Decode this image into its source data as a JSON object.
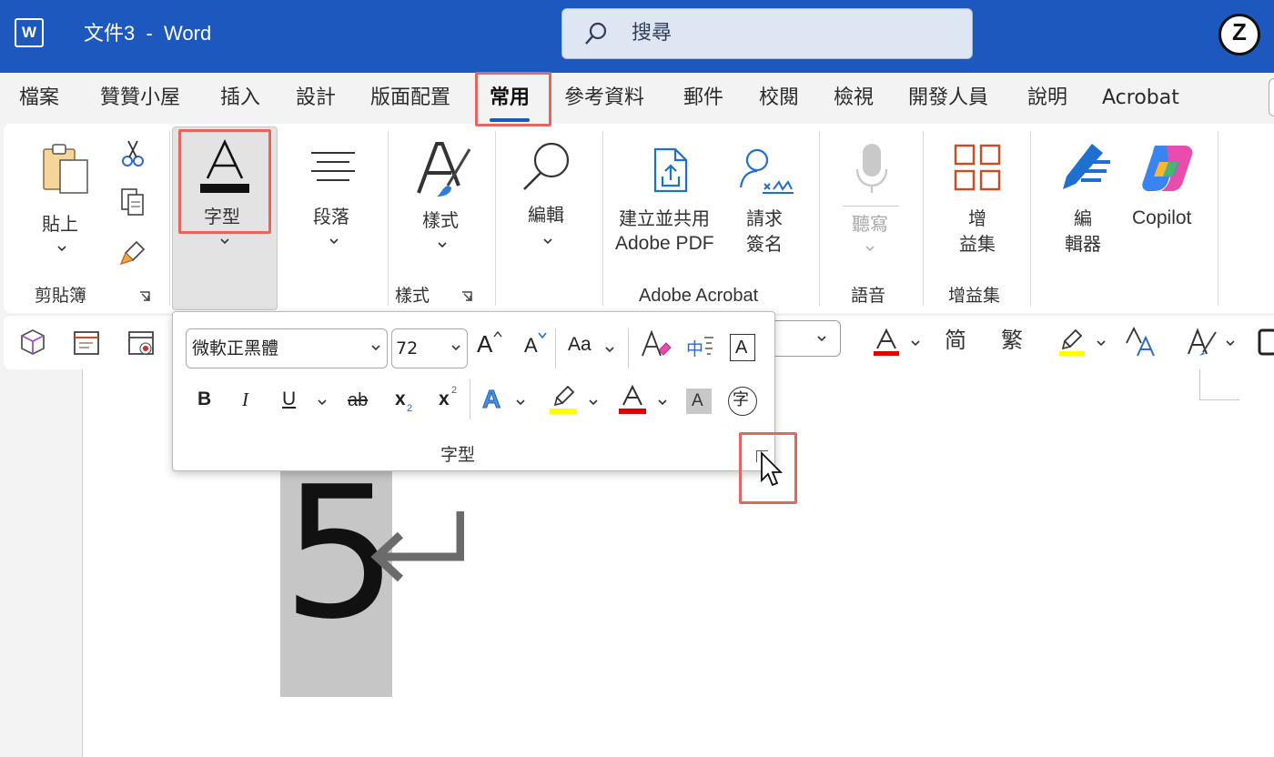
{
  "app": {
    "title": "文件3  -  Word",
    "logo": "W"
  },
  "search": {
    "placeholder": "搜尋"
  },
  "account": {
    "initial": "Z"
  },
  "tabs": [
    "檔案",
    "贊贊小屋",
    "插入",
    "設計",
    "版面配置",
    "常用",
    "參考資料",
    "郵件",
    "校閱",
    "檢視",
    "開發人員",
    "說明",
    "Acrobat"
  ],
  "selected_tab": "常用",
  "ribbon": {
    "clipboard": {
      "paste": "貼上",
      "group": "剪貼簿"
    },
    "font": {
      "button": "字型"
    },
    "paragraph": {
      "button": "段落"
    },
    "styles": {
      "button": "樣式",
      "group": "樣式"
    },
    "editing": {
      "button": "編輯"
    },
    "acrobat": {
      "create_line1": "建立並共用",
      "create_line2": "Adobe PDF",
      "sign_line1": "請求",
      "sign_line2": "簽名",
      "group": "Adobe Acrobat"
    },
    "voice": {
      "dictate": "聽寫",
      "group": "語音"
    },
    "addins": {
      "btn_line1": "增",
      "btn_line2": "益集",
      "group": "增益集"
    },
    "editor": {
      "line1": "編",
      "line2": "輯器"
    },
    "copilot": {
      "label": "Copilot"
    }
  },
  "qat": {
    "simplified": "简",
    "traditional": "繁"
  },
  "font_popup": {
    "font_name": "微軟正黑體",
    "font_size": "72",
    "grow": "A",
    "shrink": "A",
    "change_case": "Aa",
    "phonetic": "中",
    "border_char": "A",
    "bold": "B",
    "italic": "I",
    "underline": "U",
    "strike": "ab",
    "subscript": "x",
    "superscript": "x",
    "text_effects": "A",
    "font_color": "A",
    "char_shading": "A",
    "enclose": "字",
    "group_label": "字型"
  },
  "document": {
    "char": "5"
  },
  "colors": {
    "title_bar": "#1d58bf",
    "highlight_box": "#e4665f",
    "font_red": "#e00000",
    "highlight_yellow": "#ffff00",
    "tab_underline": "#1d58bf"
  }
}
